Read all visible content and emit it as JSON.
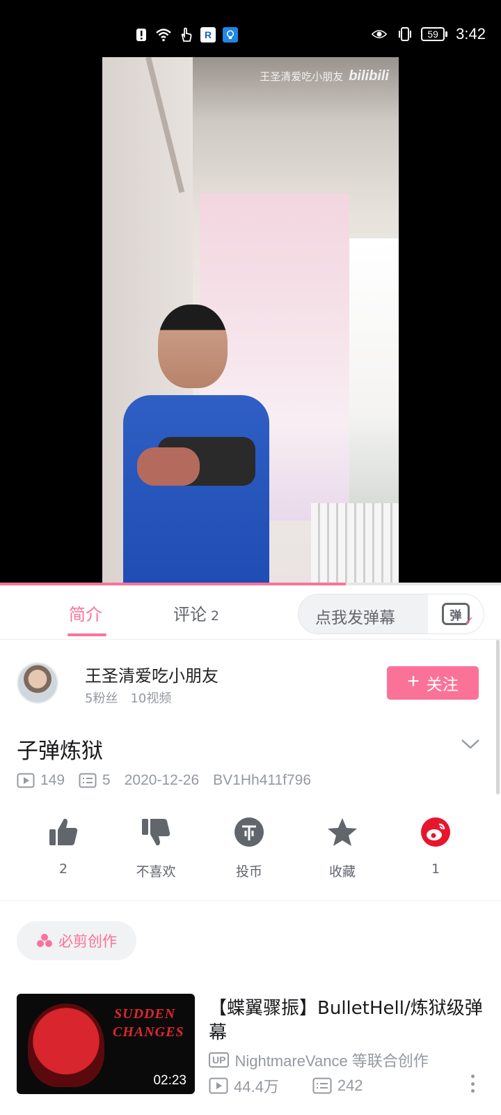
{
  "status_bar": {
    "time": "3:42",
    "battery": "59",
    "left_icons": [
      "alert-icon",
      "wifi-icon",
      "touch-icon",
      "r-app-icon",
      "bulb-app-icon"
    ],
    "right_icons": [
      "eye-icon",
      "vibrate-icon",
      "battery-icon"
    ]
  },
  "player": {
    "watermark_text": "王圣清爱吃小朋友",
    "watermark_brand": "bilibili",
    "progress": 0.69
  },
  "tabs": [
    {
      "label": "简介",
      "active": true
    },
    {
      "label": "评论",
      "count": "2",
      "active": false
    }
  ],
  "danmaku": {
    "placeholder": "点我发弹幕",
    "button_label": "弹"
  },
  "uploader": {
    "name": "王圣清爱吃小朋友",
    "fans": "5粉丝",
    "videos": "10视频",
    "follow_label": "关注"
  },
  "video": {
    "title": "子弹炼狱",
    "views": "149",
    "danmaku_count": "5",
    "date": "2020-12-26",
    "bvid": "BV1Hh411f796"
  },
  "actions": [
    {
      "icon": "thumbs-up-icon",
      "label": "2"
    },
    {
      "icon": "thumbs-down-icon",
      "label": "不喜欢"
    },
    {
      "icon": "coin-icon",
      "label": "投币"
    },
    {
      "icon": "star-icon",
      "label": "收藏"
    },
    {
      "icon": "weibo-icon",
      "label": "1"
    }
  ],
  "chip": {
    "label": "必剪创作"
  },
  "related": [
    {
      "title": "【蝶翼骤振】BulletHell/炼狱级弹幕",
      "thumb_text_1": "SUDDEN",
      "thumb_text_2": "CHANGES",
      "duration": "02:23",
      "up_badge": "UP",
      "up_text": "NightmareVance 等联合创作",
      "views": "44.4万",
      "danmaku": "242"
    }
  ],
  "colors": {
    "accent": "#fb7299",
    "muted": "#9499a0",
    "weibo": "#e6162d"
  }
}
